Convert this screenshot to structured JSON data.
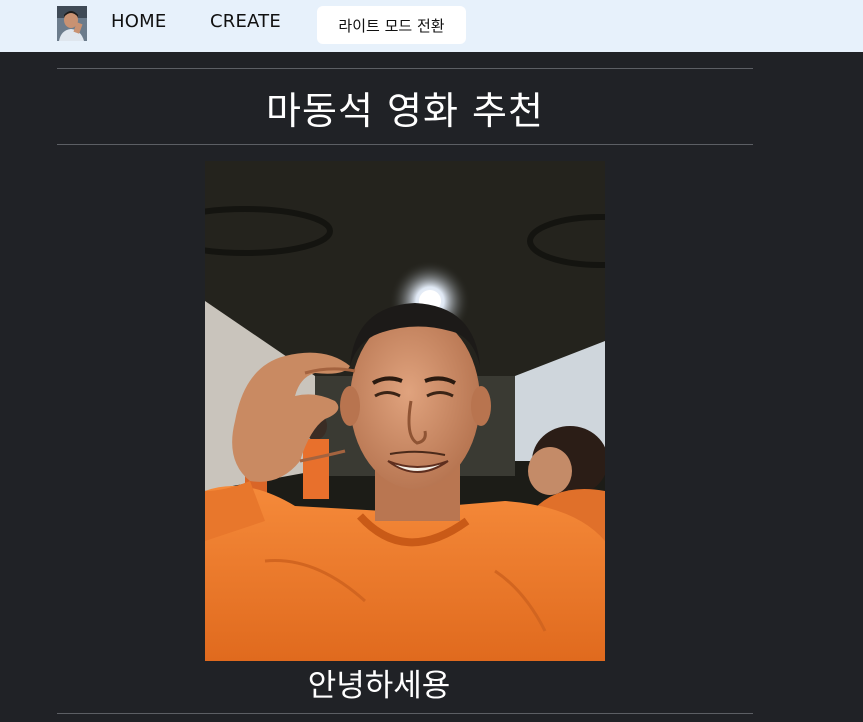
{
  "nav": {
    "home_label": "HOME",
    "create_label": "CREATE",
    "mode_toggle_label": "라이트 모드 전환",
    "avatar_icon": "profile-photo"
  },
  "main": {
    "title": "마동석 영화 추천",
    "photo_icon": "selfie-photo-smiling-man-orange-sweater",
    "caption": "안녕하세용"
  },
  "colors": {
    "nav_background": "#e7f1fb",
    "page_background": "#202226",
    "text": "#ffffff",
    "sweater_orange": "#f07d2c"
  }
}
